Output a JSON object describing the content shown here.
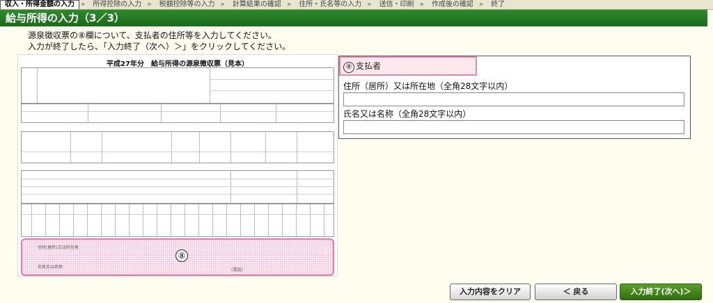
{
  "steps": {
    "items": [
      "収入・所得金額の入力",
      "所得控除の入力",
      "税額控除等の入力",
      "計算結果の確認",
      "住所・氏名等の入力",
      "送信・印刷",
      "作成後の確認",
      "終了"
    ],
    "current_index": 0
  },
  "page": {
    "title": "給与所得の入力（3／3）",
    "instruction_line1": "源泉徴収票の⑧欄について、支払者の住所等を入力してください。",
    "instruction_line2": "入力が終了したら、「入力終了（次へ）＞」をクリックしてください。"
  },
  "form_image": {
    "title": "平成27年分　給与所得の源泉徴収票（見本）",
    "marker": "⑧",
    "payer_address_label": "住所(居所)又は所在地",
    "payer_name_label": "氏名又は名称",
    "phone_label": "(電話)"
  },
  "panel": {
    "marker": "⑧",
    "heading": "支払者",
    "address_label": "住所（居所）又は所在地（全角28文字以内）",
    "address_value": "",
    "name_label": "氏名又は名称（全角28文字以内）",
    "name_value": ""
  },
  "buttons": {
    "clear": "入力内容をクリア",
    "back": "＜ 戻る",
    "next": "入力終了(次へ)＞"
  }
}
